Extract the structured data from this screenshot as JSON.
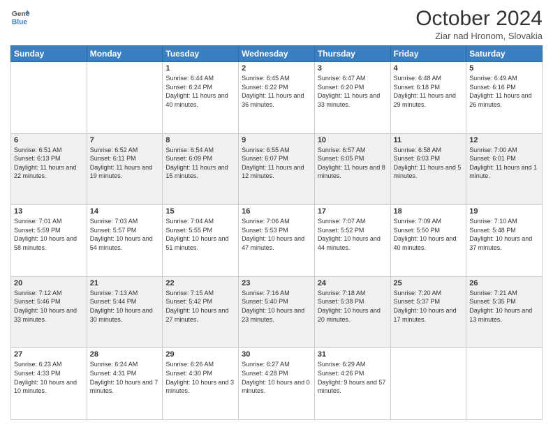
{
  "header": {
    "logo_line1": "General",
    "logo_line2": "Blue",
    "month_title": "October 2024",
    "location": "Ziar nad Hronom, Slovakia"
  },
  "weekdays": [
    "Sunday",
    "Monday",
    "Tuesday",
    "Wednesday",
    "Thursday",
    "Friday",
    "Saturday"
  ],
  "weeks": [
    [
      {
        "day": "",
        "sunrise": "",
        "sunset": "",
        "daylight": ""
      },
      {
        "day": "",
        "sunrise": "",
        "sunset": "",
        "daylight": ""
      },
      {
        "day": "1",
        "sunrise": "Sunrise: 6:44 AM",
        "sunset": "Sunset: 6:24 PM",
        "daylight": "Daylight: 11 hours and 40 minutes."
      },
      {
        "day": "2",
        "sunrise": "Sunrise: 6:45 AM",
        "sunset": "Sunset: 6:22 PM",
        "daylight": "Daylight: 11 hours and 36 minutes."
      },
      {
        "day": "3",
        "sunrise": "Sunrise: 6:47 AM",
        "sunset": "Sunset: 6:20 PM",
        "daylight": "Daylight: 11 hours and 33 minutes."
      },
      {
        "day": "4",
        "sunrise": "Sunrise: 6:48 AM",
        "sunset": "Sunset: 6:18 PM",
        "daylight": "Daylight: 11 hours and 29 minutes."
      },
      {
        "day": "5",
        "sunrise": "Sunrise: 6:49 AM",
        "sunset": "Sunset: 6:16 PM",
        "daylight": "Daylight: 11 hours and 26 minutes."
      }
    ],
    [
      {
        "day": "6",
        "sunrise": "Sunrise: 6:51 AM",
        "sunset": "Sunset: 6:13 PM",
        "daylight": "Daylight: 11 hours and 22 minutes."
      },
      {
        "day": "7",
        "sunrise": "Sunrise: 6:52 AM",
        "sunset": "Sunset: 6:11 PM",
        "daylight": "Daylight: 11 hours and 19 minutes."
      },
      {
        "day": "8",
        "sunrise": "Sunrise: 6:54 AM",
        "sunset": "Sunset: 6:09 PM",
        "daylight": "Daylight: 11 hours and 15 minutes."
      },
      {
        "day": "9",
        "sunrise": "Sunrise: 6:55 AM",
        "sunset": "Sunset: 6:07 PM",
        "daylight": "Daylight: 11 hours and 12 minutes."
      },
      {
        "day": "10",
        "sunrise": "Sunrise: 6:57 AM",
        "sunset": "Sunset: 6:05 PM",
        "daylight": "Daylight: 11 hours and 8 minutes."
      },
      {
        "day": "11",
        "sunrise": "Sunrise: 6:58 AM",
        "sunset": "Sunset: 6:03 PM",
        "daylight": "Daylight: 11 hours and 5 minutes."
      },
      {
        "day": "12",
        "sunrise": "Sunrise: 7:00 AM",
        "sunset": "Sunset: 6:01 PM",
        "daylight": "Daylight: 11 hours and 1 minute."
      }
    ],
    [
      {
        "day": "13",
        "sunrise": "Sunrise: 7:01 AM",
        "sunset": "Sunset: 5:59 PM",
        "daylight": "Daylight: 10 hours and 58 minutes."
      },
      {
        "day": "14",
        "sunrise": "Sunrise: 7:03 AM",
        "sunset": "Sunset: 5:57 PM",
        "daylight": "Daylight: 10 hours and 54 minutes."
      },
      {
        "day": "15",
        "sunrise": "Sunrise: 7:04 AM",
        "sunset": "Sunset: 5:55 PM",
        "daylight": "Daylight: 10 hours and 51 minutes."
      },
      {
        "day": "16",
        "sunrise": "Sunrise: 7:06 AM",
        "sunset": "Sunset: 5:53 PM",
        "daylight": "Daylight: 10 hours and 47 minutes."
      },
      {
        "day": "17",
        "sunrise": "Sunrise: 7:07 AM",
        "sunset": "Sunset: 5:52 PM",
        "daylight": "Daylight: 10 hours and 44 minutes."
      },
      {
        "day": "18",
        "sunrise": "Sunrise: 7:09 AM",
        "sunset": "Sunset: 5:50 PM",
        "daylight": "Daylight: 10 hours and 40 minutes."
      },
      {
        "day": "19",
        "sunrise": "Sunrise: 7:10 AM",
        "sunset": "Sunset: 5:48 PM",
        "daylight": "Daylight: 10 hours and 37 minutes."
      }
    ],
    [
      {
        "day": "20",
        "sunrise": "Sunrise: 7:12 AM",
        "sunset": "Sunset: 5:46 PM",
        "daylight": "Daylight: 10 hours and 33 minutes."
      },
      {
        "day": "21",
        "sunrise": "Sunrise: 7:13 AM",
        "sunset": "Sunset: 5:44 PM",
        "daylight": "Daylight: 10 hours and 30 minutes."
      },
      {
        "day": "22",
        "sunrise": "Sunrise: 7:15 AM",
        "sunset": "Sunset: 5:42 PM",
        "daylight": "Daylight: 10 hours and 27 minutes."
      },
      {
        "day": "23",
        "sunrise": "Sunrise: 7:16 AM",
        "sunset": "Sunset: 5:40 PM",
        "daylight": "Daylight: 10 hours and 23 minutes."
      },
      {
        "day": "24",
        "sunrise": "Sunrise: 7:18 AM",
        "sunset": "Sunset: 5:38 PM",
        "daylight": "Daylight: 10 hours and 20 minutes."
      },
      {
        "day": "25",
        "sunrise": "Sunrise: 7:20 AM",
        "sunset": "Sunset: 5:37 PM",
        "daylight": "Daylight: 10 hours and 17 minutes."
      },
      {
        "day": "26",
        "sunrise": "Sunrise: 7:21 AM",
        "sunset": "Sunset: 5:35 PM",
        "daylight": "Daylight: 10 hours and 13 minutes."
      }
    ],
    [
      {
        "day": "27",
        "sunrise": "Sunrise: 6:23 AM",
        "sunset": "Sunset: 4:33 PM",
        "daylight": "Daylight: 10 hours and 10 minutes."
      },
      {
        "day": "28",
        "sunrise": "Sunrise: 6:24 AM",
        "sunset": "Sunset: 4:31 PM",
        "daylight": "Daylight: 10 hours and 7 minutes."
      },
      {
        "day": "29",
        "sunrise": "Sunrise: 6:26 AM",
        "sunset": "Sunset: 4:30 PM",
        "daylight": "Daylight: 10 hours and 3 minutes."
      },
      {
        "day": "30",
        "sunrise": "Sunrise: 6:27 AM",
        "sunset": "Sunset: 4:28 PM",
        "daylight": "Daylight: 10 hours and 0 minutes."
      },
      {
        "day": "31",
        "sunrise": "Sunrise: 6:29 AM",
        "sunset": "Sunset: 4:26 PM",
        "daylight": "Daylight: 9 hours and 57 minutes."
      },
      {
        "day": "",
        "sunrise": "",
        "sunset": "",
        "daylight": ""
      },
      {
        "day": "",
        "sunrise": "",
        "sunset": "",
        "daylight": ""
      }
    ]
  ]
}
